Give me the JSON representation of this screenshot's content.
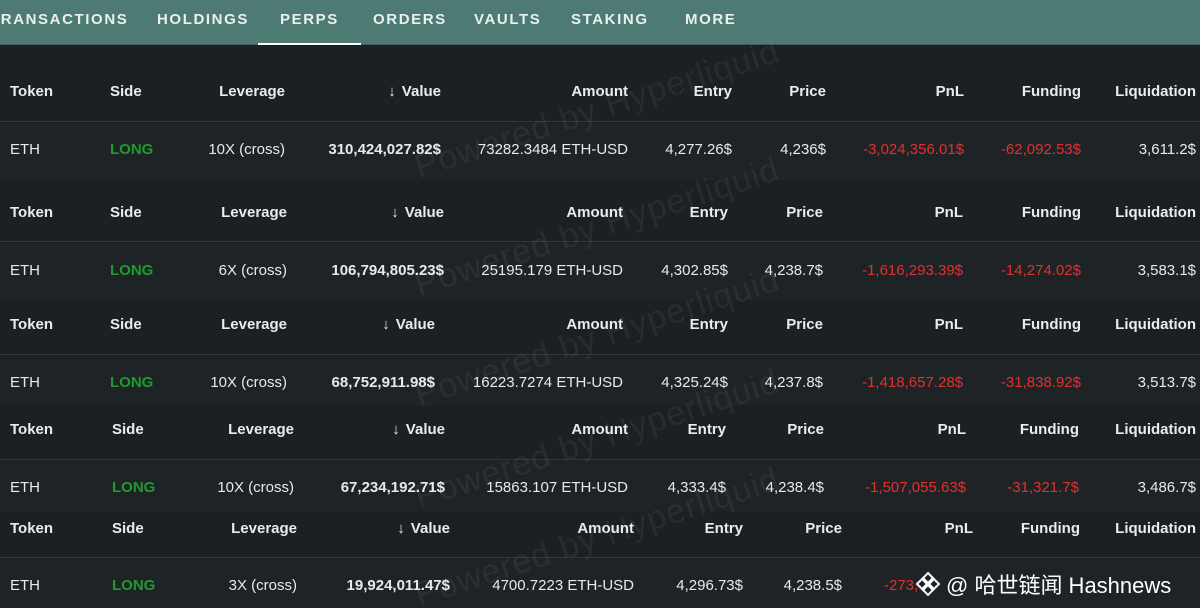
{
  "tabs": [
    {
      "label": "TRANSACTIONS"
    },
    {
      "label": "HOLDINGS"
    },
    {
      "label": "PERPS",
      "active": true
    },
    {
      "label": "ORDERS"
    },
    {
      "label": "VAULTS"
    },
    {
      "label": "STAKING"
    },
    {
      "label": "MORE"
    }
  ],
  "columns": {
    "token": "Token",
    "side": "Side",
    "leverage": "Leverage",
    "value": "Value",
    "amount": "Amount",
    "entry": "Entry",
    "price": "Price",
    "pnl": "PnL",
    "funding": "Funding",
    "liquidation": "Liquidation"
  },
  "positions": [
    {
      "token": "ETH",
      "side": "LONG",
      "leverage": "10X (cross)",
      "value": "310,424,027.82$",
      "amount": "73282.3484 ETH-USD",
      "entry": "4,277.26$",
      "price": "4,236$",
      "pnl": "-3,024,356.01$",
      "funding": "-62,092.53$",
      "liquidation": "3,611.2$"
    },
    {
      "token": "ETH",
      "side": "LONG",
      "leverage": "6X (cross)",
      "value": "106,794,805.23$",
      "amount": "25195.179 ETH-USD",
      "entry": "4,302.85$",
      "price": "4,238.7$",
      "pnl": "-1,616,293.39$",
      "funding": "-14,274.02$",
      "liquidation": "3,583.1$"
    },
    {
      "token": "ETH",
      "side": "LONG",
      "leverage": "10X (cross)",
      "value": "68,752,911.98$",
      "amount": "16223.7274 ETH-USD",
      "entry": "4,325.24$",
      "price": "4,237.8$",
      "pnl": "-1,418,657.28$",
      "funding": "-31,838.92$",
      "liquidation": "3,513.7$"
    },
    {
      "token": "ETH",
      "side": "LONG",
      "leverage": "10X (cross)",
      "value": "67,234,192.71$",
      "amount": "15863.107 ETH-USD",
      "entry": "4,333.4$",
      "price": "4,238.4$",
      "pnl": "-1,507,055.63$",
      "funding": "-31,321.7$",
      "liquidation": "3,486.7$"
    },
    {
      "token": "ETH",
      "side": "LONG",
      "leverage": "3X (cross)",
      "value": "19,924,011.47$",
      "amount": "4700.7223 ETH-USD",
      "entry": "4,296.73$",
      "price": "4,238.5$",
      "pnl": "-273,",
      "funding": "",
      "liquidation": ""
    }
  ],
  "watermark": "Powered by Hyperliquid",
  "corner_label": "@ 哈世链闻 Hashnews",
  "colors": {
    "tabbar": "#4d7a72",
    "long": "#1f9a2c",
    "negative": "#e03030",
    "background": "#1b2022"
  },
  "icons": {
    "sort": "arrow-down-icon",
    "logo": "binance-diamond-icon"
  }
}
